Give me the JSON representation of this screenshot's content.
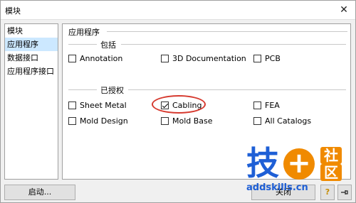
{
  "window": {
    "title": "模块"
  },
  "sidebar": {
    "items": [
      {
        "label": "模块"
      },
      {
        "label": "应用程序",
        "selected": true
      },
      {
        "label": "数据接口"
      },
      {
        "label": "应用程序接口"
      }
    ]
  },
  "main": {
    "title": "应用程序",
    "included": {
      "label": "包括",
      "options": [
        {
          "label": "Annotation",
          "checked": false
        },
        {
          "label": "3D Documentation",
          "checked": false
        },
        {
          "label": "PCB",
          "checked": false
        }
      ]
    },
    "licensed": {
      "label": "已授权",
      "options": [
        {
          "label": "Sheet Metal",
          "checked": false
        },
        {
          "label": "Cabling",
          "checked": true
        },
        {
          "label": "FEA",
          "checked": false
        },
        {
          "label": "Mold Design",
          "checked": false
        },
        {
          "label": "Mold Base",
          "checked": false
        },
        {
          "label": "All Catalogs",
          "checked": false
        }
      ]
    }
  },
  "footer": {
    "start_label": "启动...",
    "close_label": "关闭",
    "help_icon": "question-icon",
    "pin_icon": "pin-icon"
  },
  "watermark": {
    "main": "技",
    "plus": "+",
    "side_top": "社",
    "side_bottom": "区",
    "url": "addskills.cn"
  },
  "colors": {
    "selection": "#cce8ff",
    "highlight": "#d63a2f",
    "watermark_blue": "#1e5fd6",
    "watermark_orange": "#f08a00"
  }
}
